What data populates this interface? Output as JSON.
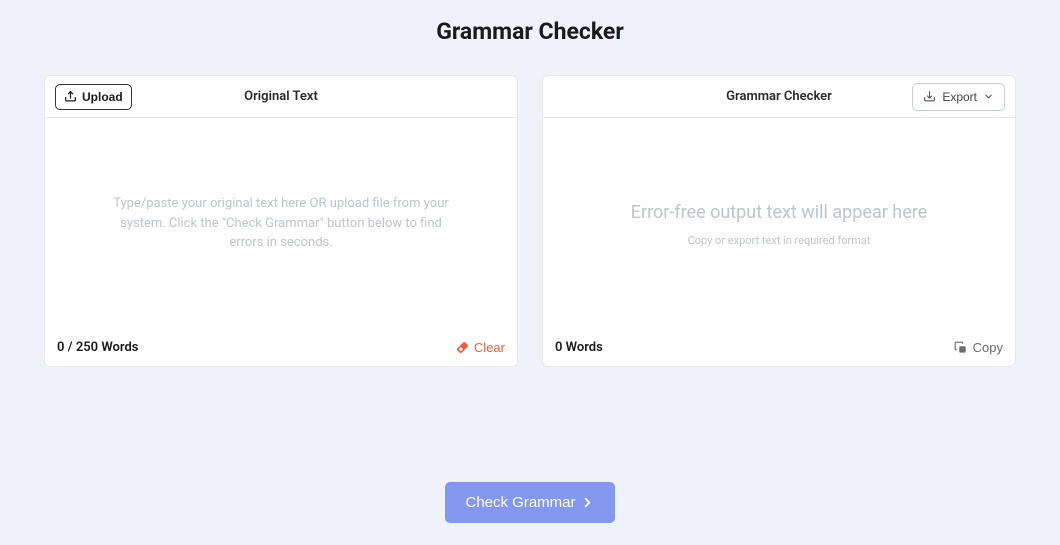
{
  "title": "Grammar Checker",
  "input_panel": {
    "upload_label": "Upload",
    "title": "Original Text",
    "placeholder": "Type/paste your original text here OR upload file from your system. Click the \"Check Grammar\" button below to find errors in seconds.",
    "word_count": "0 / 250 Words",
    "clear_label": "Clear"
  },
  "output_panel": {
    "title": "Grammar Checker",
    "export_label": "Export",
    "placeholder_title": "Error-free output text will appear here",
    "placeholder_sub": "Copy or export text in required format",
    "word_count": "0 Words",
    "copy_label": "Copy"
  },
  "action": {
    "check_label": "Check Grammar"
  }
}
